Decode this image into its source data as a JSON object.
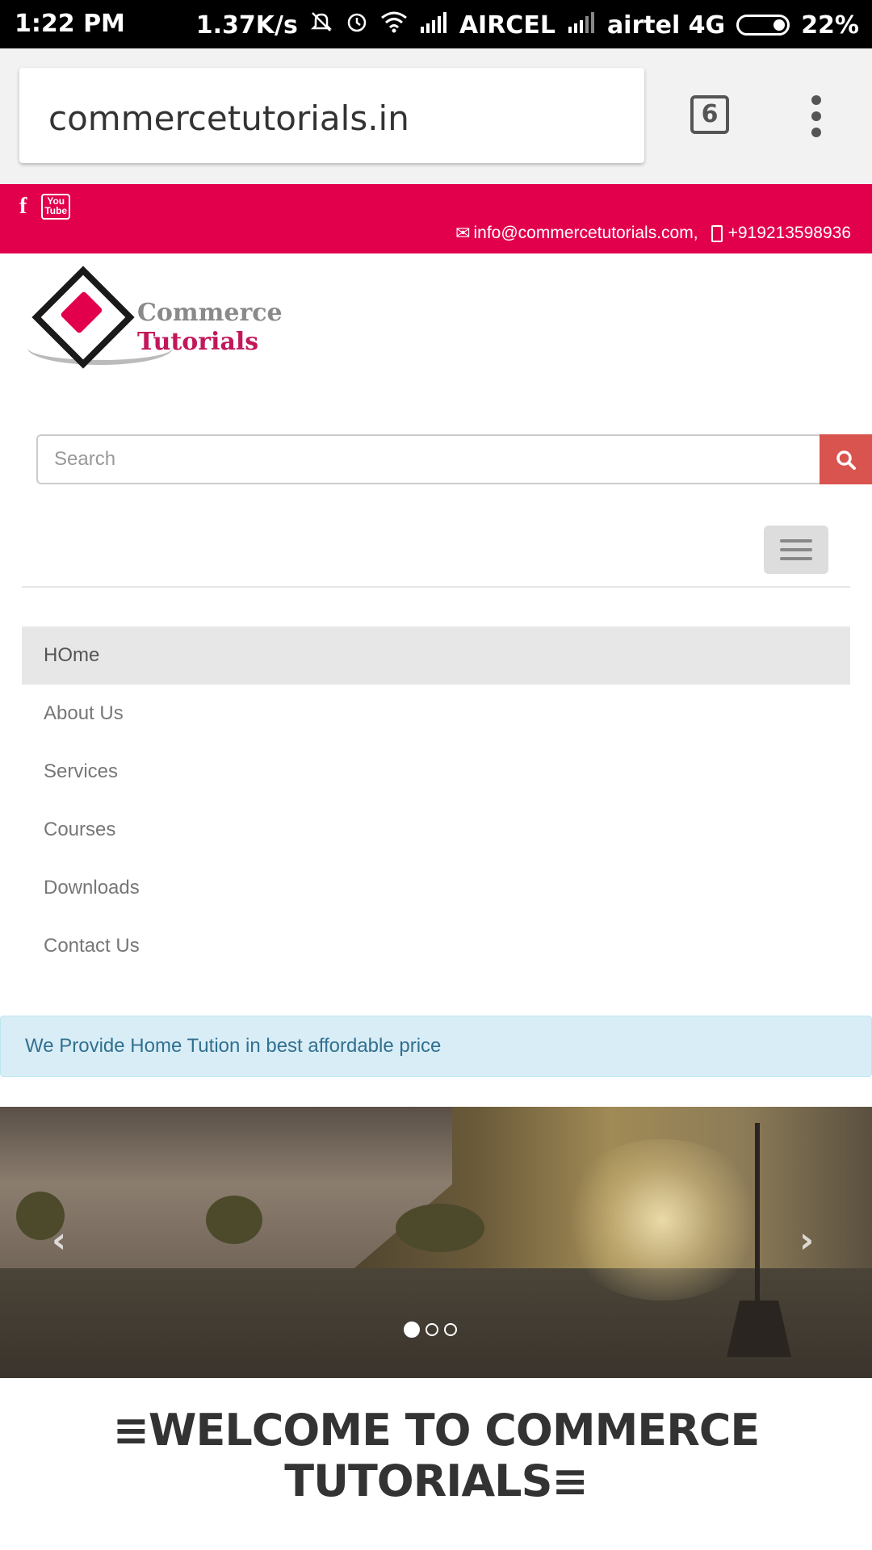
{
  "status_bar": {
    "time": "1:22 PM",
    "speed": "1.37K/s",
    "carrier1": "AIRCEL",
    "carrier2": "airtel 4G",
    "battery": "22%"
  },
  "browser": {
    "url": "commercetutorials.in",
    "tab_count": "6"
  },
  "topbar": {
    "social_icons": [
      "facebook-icon",
      "youtube-icon"
    ],
    "facebook_glyph": "f",
    "youtube_glyph_top": "You",
    "youtube_glyph_bottom": "Tube",
    "email": "info@commercetutorials.com,",
    "phone": "+919213598936",
    "color": "#e2004d"
  },
  "logo": {
    "line1": "Commerce",
    "line2": "Tutorials"
  },
  "search": {
    "placeholder": "Search",
    "button_color": "#d9534f"
  },
  "nav": {
    "items": [
      {
        "label": "HOme",
        "active": true
      },
      {
        "label": "About Us"
      },
      {
        "label": "Services"
      },
      {
        "label": "Courses"
      },
      {
        "label": "Downloads"
      },
      {
        "label": "Contact Us"
      }
    ]
  },
  "alert": {
    "text": "We Provide Home Tution in best affordable price"
  },
  "carousel": {
    "slide_count": 3,
    "active_index": 0
  },
  "welcome": {
    "title": "≡WELCOME TO COMMERCE TUTORIALS≡"
  }
}
